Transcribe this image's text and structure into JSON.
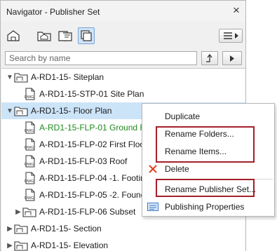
{
  "window": {
    "title": "Navigator - Publisher Set",
    "close_glyph": "×"
  },
  "toolbar": {
    "buttons": [
      "project-map-icon",
      "view-map-icon",
      "layout-book-icon",
      "publisher-sets-icon"
    ],
    "active": "publisher-sets-icon"
  },
  "search": {
    "placeholder": "Search by name",
    "value": ""
  },
  "tree": {
    "rows": [
      {
        "label": "A-RD1-15- Siteplan",
        "type": "folder",
        "expanded": true
      },
      {
        "label": "A-RD1-15-STP-01 Site Plan",
        "type": "dwg"
      },
      {
        "label": "A-RD1-15- Floor Plan",
        "type": "folder",
        "expanded": true,
        "selected": true
      },
      {
        "label": "A-RD1-15-FLP-01 Ground Flo",
        "type": "dwg",
        "color": "#1e8a1e"
      },
      {
        "label": "A-RD1-15-FLP-02 First Floor",
        "type": "dwg"
      },
      {
        "label": "A-RD1-15-FLP-03 Roof",
        "type": "dwg"
      },
      {
        "label": "A-RD1-15-FLP-04 -1. Footing",
        "type": "dwg"
      },
      {
        "label": "A-RD1-15-FLP-05 -2. Foundat",
        "type": "dwg"
      },
      {
        "label": "A-RD1-15-FLP-06 Subset",
        "type": "subset",
        "expanded": false
      },
      {
        "label": "A-RD1-15- Section",
        "type": "folder",
        "expanded": false
      },
      {
        "label": "A-RD1-15- Elevation",
        "type": "folder",
        "expanded": false
      }
    ]
  },
  "context_menu": {
    "items": [
      {
        "label": "Duplicate",
        "icon": ""
      },
      {
        "label": "Rename Folders...",
        "icon": ""
      },
      {
        "label": "Rename Items...",
        "icon": ""
      },
      {
        "label": "Delete",
        "icon": "delete-x-icon"
      },
      {
        "label": "Rename Publisher Set...",
        "icon": ""
      },
      {
        "label": "Publishing Properties",
        "icon": "properties-icon"
      }
    ],
    "highlight_color": "#a3202a",
    "delete_icon_color": "#e0401e"
  },
  "dwg_text": "DWG",
  "colors": {
    "selection": "#cce4f8",
    "accent": "#3b78c8"
  }
}
